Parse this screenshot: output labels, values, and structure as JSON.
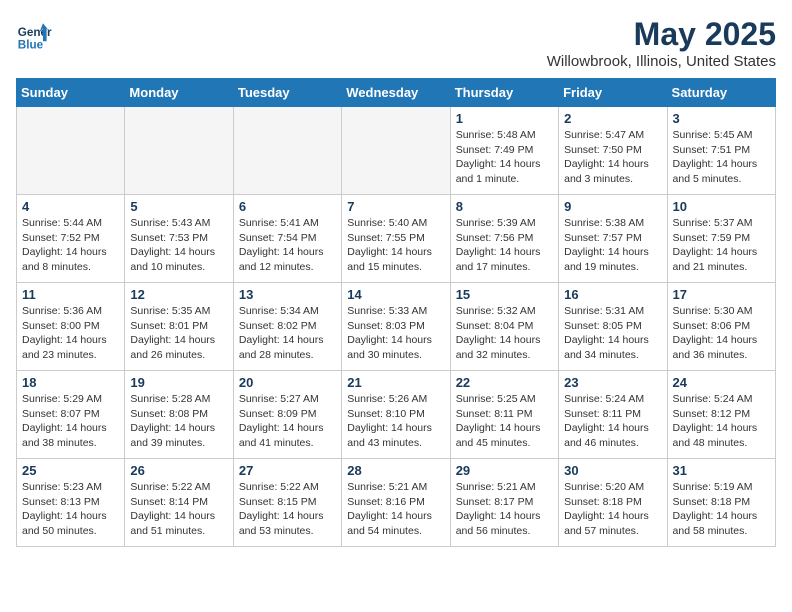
{
  "logo": {
    "line1": "General",
    "line2": "Blue"
  },
  "title": "May 2025",
  "subtitle": "Willowbrook, Illinois, United States",
  "headers": [
    "Sunday",
    "Monday",
    "Tuesday",
    "Wednesday",
    "Thursday",
    "Friday",
    "Saturday"
  ],
  "weeks": [
    [
      {
        "num": "",
        "info": ""
      },
      {
        "num": "",
        "info": ""
      },
      {
        "num": "",
        "info": ""
      },
      {
        "num": "",
        "info": ""
      },
      {
        "num": "1",
        "info": "Sunrise: 5:48 AM\nSunset: 7:49 PM\nDaylight: 14 hours\nand 1 minute."
      },
      {
        "num": "2",
        "info": "Sunrise: 5:47 AM\nSunset: 7:50 PM\nDaylight: 14 hours\nand 3 minutes."
      },
      {
        "num": "3",
        "info": "Sunrise: 5:45 AM\nSunset: 7:51 PM\nDaylight: 14 hours\nand 5 minutes."
      }
    ],
    [
      {
        "num": "4",
        "info": "Sunrise: 5:44 AM\nSunset: 7:52 PM\nDaylight: 14 hours\nand 8 minutes."
      },
      {
        "num": "5",
        "info": "Sunrise: 5:43 AM\nSunset: 7:53 PM\nDaylight: 14 hours\nand 10 minutes."
      },
      {
        "num": "6",
        "info": "Sunrise: 5:41 AM\nSunset: 7:54 PM\nDaylight: 14 hours\nand 12 minutes."
      },
      {
        "num": "7",
        "info": "Sunrise: 5:40 AM\nSunset: 7:55 PM\nDaylight: 14 hours\nand 15 minutes."
      },
      {
        "num": "8",
        "info": "Sunrise: 5:39 AM\nSunset: 7:56 PM\nDaylight: 14 hours\nand 17 minutes."
      },
      {
        "num": "9",
        "info": "Sunrise: 5:38 AM\nSunset: 7:57 PM\nDaylight: 14 hours\nand 19 minutes."
      },
      {
        "num": "10",
        "info": "Sunrise: 5:37 AM\nSunset: 7:59 PM\nDaylight: 14 hours\nand 21 minutes."
      }
    ],
    [
      {
        "num": "11",
        "info": "Sunrise: 5:36 AM\nSunset: 8:00 PM\nDaylight: 14 hours\nand 23 minutes."
      },
      {
        "num": "12",
        "info": "Sunrise: 5:35 AM\nSunset: 8:01 PM\nDaylight: 14 hours\nand 26 minutes."
      },
      {
        "num": "13",
        "info": "Sunrise: 5:34 AM\nSunset: 8:02 PM\nDaylight: 14 hours\nand 28 minutes."
      },
      {
        "num": "14",
        "info": "Sunrise: 5:33 AM\nSunset: 8:03 PM\nDaylight: 14 hours\nand 30 minutes."
      },
      {
        "num": "15",
        "info": "Sunrise: 5:32 AM\nSunset: 8:04 PM\nDaylight: 14 hours\nand 32 minutes."
      },
      {
        "num": "16",
        "info": "Sunrise: 5:31 AM\nSunset: 8:05 PM\nDaylight: 14 hours\nand 34 minutes."
      },
      {
        "num": "17",
        "info": "Sunrise: 5:30 AM\nSunset: 8:06 PM\nDaylight: 14 hours\nand 36 minutes."
      }
    ],
    [
      {
        "num": "18",
        "info": "Sunrise: 5:29 AM\nSunset: 8:07 PM\nDaylight: 14 hours\nand 38 minutes."
      },
      {
        "num": "19",
        "info": "Sunrise: 5:28 AM\nSunset: 8:08 PM\nDaylight: 14 hours\nand 39 minutes."
      },
      {
        "num": "20",
        "info": "Sunrise: 5:27 AM\nSunset: 8:09 PM\nDaylight: 14 hours\nand 41 minutes."
      },
      {
        "num": "21",
        "info": "Sunrise: 5:26 AM\nSunset: 8:10 PM\nDaylight: 14 hours\nand 43 minutes."
      },
      {
        "num": "22",
        "info": "Sunrise: 5:25 AM\nSunset: 8:11 PM\nDaylight: 14 hours\nand 45 minutes."
      },
      {
        "num": "23",
        "info": "Sunrise: 5:24 AM\nSunset: 8:11 PM\nDaylight: 14 hours\nand 46 minutes."
      },
      {
        "num": "24",
        "info": "Sunrise: 5:24 AM\nSunset: 8:12 PM\nDaylight: 14 hours\nand 48 minutes."
      }
    ],
    [
      {
        "num": "25",
        "info": "Sunrise: 5:23 AM\nSunset: 8:13 PM\nDaylight: 14 hours\nand 50 minutes."
      },
      {
        "num": "26",
        "info": "Sunrise: 5:22 AM\nSunset: 8:14 PM\nDaylight: 14 hours\nand 51 minutes."
      },
      {
        "num": "27",
        "info": "Sunrise: 5:22 AM\nSunset: 8:15 PM\nDaylight: 14 hours\nand 53 minutes."
      },
      {
        "num": "28",
        "info": "Sunrise: 5:21 AM\nSunset: 8:16 PM\nDaylight: 14 hours\nand 54 minutes."
      },
      {
        "num": "29",
        "info": "Sunrise: 5:21 AM\nSunset: 8:17 PM\nDaylight: 14 hours\nand 56 minutes."
      },
      {
        "num": "30",
        "info": "Sunrise: 5:20 AM\nSunset: 8:18 PM\nDaylight: 14 hours\nand 57 minutes."
      },
      {
        "num": "31",
        "info": "Sunrise: 5:19 AM\nSunset: 8:18 PM\nDaylight: 14 hours\nand 58 minutes."
      }
    ]
  ]
}
